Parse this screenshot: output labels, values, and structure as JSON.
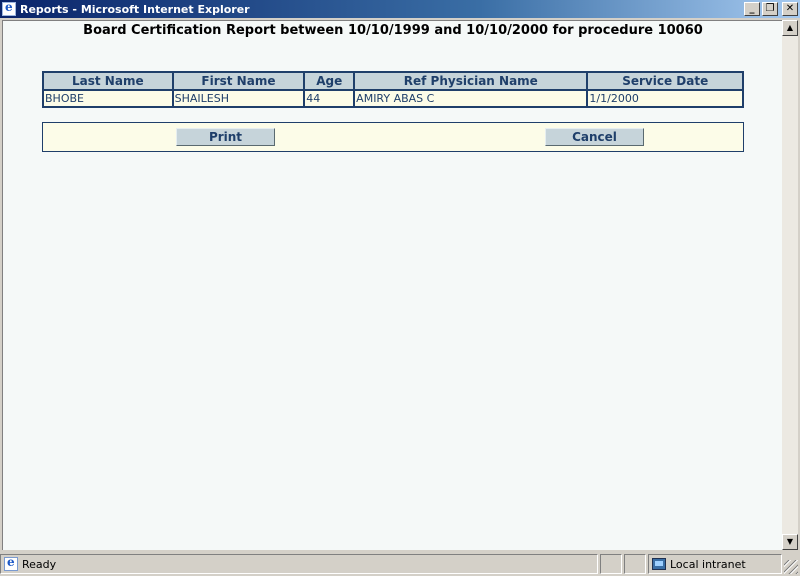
{
  "window": {
    "title": "Reports - Microsoft Internet Explorer",
    "minimize": "_",
    "restore": "❐",
    "close": "✕"
  },
  "report": {
    "title": "Board Certification Report between 10/10/1999 and 10/10/2000 for procedure 10060",
    "columns": [
      "Last Name",
      "First Name",
      "Age",
      "Ref Physician Name",
      "Service Date"
    ],
    "rows": [
      [
        "BHOBE",
        "SHAILESH",
        "44",
        "AMIRY ABAS C",
        "1/1/2000"
      ]
    ]
  },
  "buttons": {
    "print": "Print",
    "cancel": "Cancel"
  },
  "scrollbar": {
    "up": "▲",
    "down": "▼"
  },
  "status": {
    "text": "Ready",
    "zone": "Local intranet"
  },
  "icons": {
    "app": "ie-icon",
    "status": "ie-page-icon",
    "zone": "local-intranet-icon"
  }
}
